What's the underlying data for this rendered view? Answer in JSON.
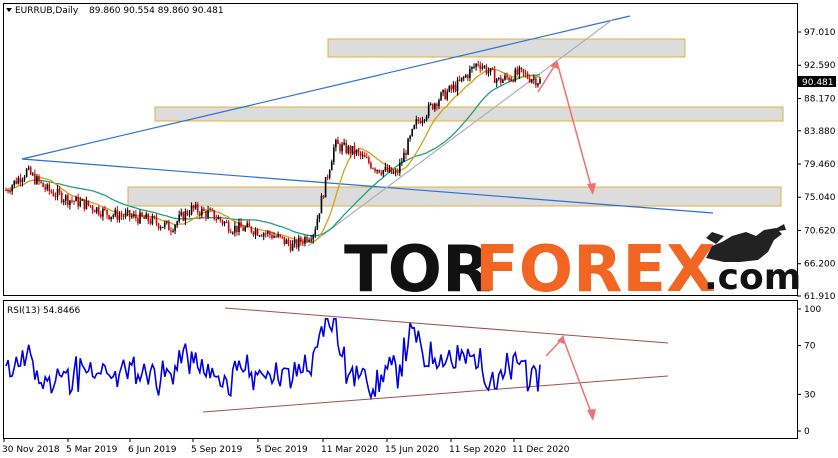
{
  "header": {
    "symbol_label": "EURRUB,Daily",
    "ohlc_label": "89.860 90.554 89.860 90.481"
  },
  "price_panel": {
    "y_ticks": [
      "97.010",
      "92.590",
      "88.170",
      "83.880",
      "79.460",
      "75.040",
      "70.620",
      "66.200",
      "61.910"
    ],
    "current_price": "90.481"
  },
  "rsi_panel": {
    "label": "RSI(13) 54.8466",
    "y_ticks": [
      "100",
      "70",
      "30",
      "0"
    ]
  },
  "x_ticks": [
    "30 Nov 2018",
    "5 Mar 2019",
    "6 Jun 2019",
    "5 Sep 2019",
    "5 Dec 2019",
    "11 Mar 2020",
    "15 Jun 2020",
    "11 Sep 2020",
    "11 Dec 2020"
  ],
  "logo": {
    "part1": "TOR",
    "part2": "FOREX",
    "part3": ".com"
  },
  "colors": {
    "candle_up": "#000000",
    "candle_down": "#d40000",
    "ma_fast": "#d4a017",
    "ma_slow": "#20a080",
    "trendline": "#2b6fd6",
    "trend_grey": "#b0b0b0",
    "rsi_line": "#0000e0",
    "rsi_channel": "#a05050",
    "forecast_arrow": "#f07070",
    "zone_fill": "#d8d8d8",
    "zone_border": "#e0b040",
    "brand_orange": "#f26522"
  },
  "chart_data": [
    {
      "type": "candlestick",
      "title": "EURRUB,Daily",
      "y_axis": "price",
      "ylim": [
        61.91,
        99.0
      ],
      "x_ticks": [
        "30 Nov 2018",
        "5 Mar 2019",
        "6 Jun 2019",
        "5 Sep 2019",
        "5 Dec 2019",
        "11 Mar 2020",
        "15 Jun 2020",
        "11 Sep 2020",
        "11 Dec 2020"
      ],
      "series_close_approx": [
        {
          "x": "30 Nov 2018",
          "y": 76.0
        },
        {
          "x": "Dec 2018",
          "y": 78.5
        },
        {
          "x": "Jan 2019",
          "y": 76.0
        },
        {
          "x": "Feb 2019",
          "y": 74.8
        },
        {
          "x": "5 Mar 2019",
          "y": 74.0
        },
        {
          "x": "Apr 2019",
          "y": 72.8
        },
        {
          "x": "May 2019",
          "y": 72.5
        },
        {
          "x": "6 Jun 2019",
          "y": 72.0
        },
        {
          "x": "Jul 2019",
          "y": 71.0
        },
        {
          "x": "Aug 2019",
          "y": 73.5
        },
        {
          "x": "5 Sep 2019",
          "y": 72.8
        },
        {
          "x": "Oct 2019",
          "y": 71.0
        },
        {
          "x": "Nov 2019",
          "y": 70.8
        },
        {
          "x": "5 Dec 2019",
          "y": 70.0
        },
        {
          "x": "Jan 2020",
          "y": 68.5
        },
        {
          "x": "Feb 2020",
          "y": 70.5
        },
        {
          "x": "11 Mar 2020",
          "y": 82.0
        },
        {
          "x": "Apr 2020",
          "y": 81.0
        },
        {
          "x": "May 2020",
          "y": 79.0
        },
        {
          "x": "15 Jun 2020",
          "y": 78.0
        },
        {
          "x": "Jul 2020",
          "y": 85.0
        },
        {
          "x": "Aug 2020",
          "y": 88.0
        },
        {
          "x": "11 Sep 2020",
          "y": 90.0
        },
        {
          "x": "Oct 2020",
          "y": 93.0
        },
        {
          "x": "Nov 2020",
          "y": 90.5
        },
        {
          "x": "11 Dec 2020",
          "y": 91.5
        },
        {
          "x": "Jan 2021",
          "y": 90.481
        }
      ],
      "zones": [
        [
          94.2,
          96.9
        ],
        [
          84.9,
          86.8
        ],
        [
          73.4,
          76.2
        ]
      ],
      "current_price": 90.481
    },
    {
      "type": "line",
      "title": "RSI(13) 54.8466",
      "ylim": [
        0,
        100
      ],
      "levels": [
        30,
        70
      ],
      "current_value": 54.8466
    }
  ]
}
